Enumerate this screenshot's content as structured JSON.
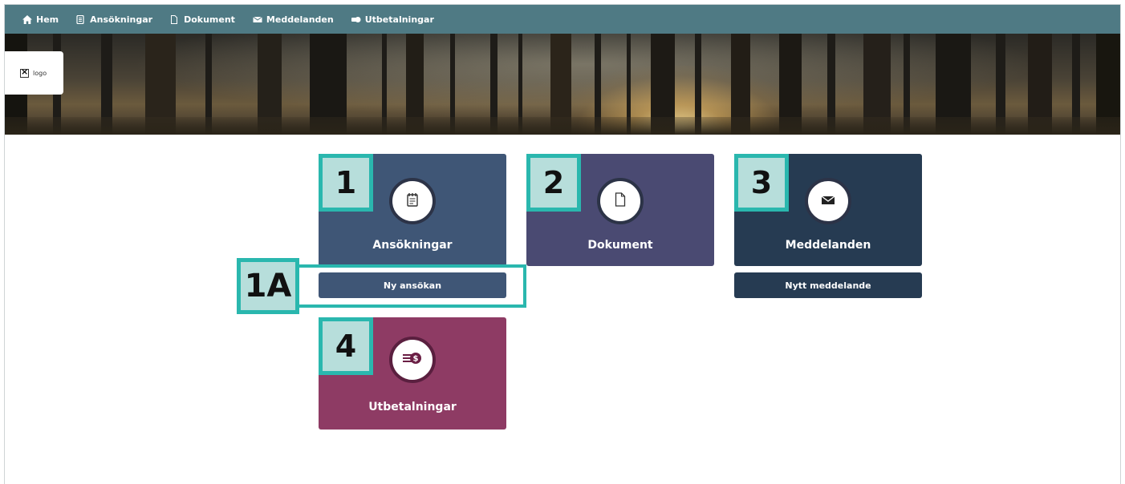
{
  "nav": {
    "items": [
      {
        "label": "Hem",
        "icon": "home-icon"
      },
      {
        "label": "Ansökningar",
        "icon": "document-list-icon"
      },
      {
        "label": "Dokument",
        "icon": "file-icon"
      },
      {
        "label": "Meddelanden",
        "icon": "envelope-icon"
      },
      {
        "label": "Utbetalningar",
        "icon": "money-icon"
      }
    ]
  },
  "logo": {
    "alt": "logo"
  },
  "tiles": [
    {
      "label": "Ansökningar",
      "badge": "1",
      "icon": "notepad-icon",
      "color": "#3f5676"
    },
    {
      "label": "Dokument",
      "badge": "2",
      "icon": "file-icon",
      "color": "#4a4a72"
    },
    {
      "label": "Meddelanden",
      "badge": "3",
      "icon": "envelope-icon",
      "color": "#263b52"
    },
    {
      "label": "Utbetalningar",
      "badge": "4",
      "icon": "money-icon",
      "color": "#8e3b64"
    }
  ],
  "actions": {
    "new_application": {
      "label": "Ny ansökan",
      "badge": "1A",
      "color": "#3f5676"
    },
    "new_message": {
      "label": "Nytt meddelande",
      "color": "#263b52"
    }
  },
  "colors": {
    "nav": "#4f7a84",
    "highlight": "#2ab7ae",
    "badge_fill": "#b7dedb"
  }
}
